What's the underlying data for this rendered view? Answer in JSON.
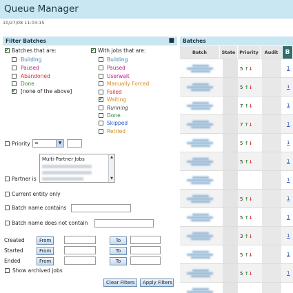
{
  "header": {
    "title": "Queue Manager",
    "timestamp": "10/27/08 11:03:15"
  },
  "filter": {
    "title": "Filter Batches",
    "collapse_icon": "collapse-icon",
    "batches_that_are": {
      "label": "Batches that are:",
      "checked": true,
      "options": [
        {
          "label": "Building",
          "checked": false,
          "color": "#3a7fb0"
        },
        {
          "label": "Paused",
          "checked": false,
          "color": "#c2188c"
        },
        {
          "label": "Abandoned",
          "checked": false,
          "color": "#d43030"
        },
        {
          "label": "Done",
          "checked": false,
          "color": "#2f8a40"
        },
        {
          "label": "[none of the above]",
          "checked": true,
          "color": "#222222"
        }
      ]
    },
    "jobs_that_are": {
      "label": "With jobs that are:",
      "checked": true,
      "options": [
        {
          "label": "Building",
          "checked": false
        },
        {
          "label": "Paused",
          "checked": false
        },
        {
          "label": "Userwait",
          "checked": false
        },
        {
          "label": "Manually Forced",
          "checked": false
        },
        {
          "label": "Failed",
          "checked": false
        },
        {
          "label": "Waiting",
          "checked": true
        },
        {
          "label": "Running",
          "checked": false
        },
        {
          "label": "Done",
          "checked": false
        },
        {
          "label": "Skipped",
          "checked": false
        },
        {
          "label": "Retried",
          "checked": false
        }
      ]
    },
    "priority": {
      "label": "Priority",
      "operator": "=",
      "value": ""
    },
    "partner": {
      "label": "Partner is",
      "first_option": "Multi-Partner Jobs"
    },
    "current_entity": {
      "label": "Current entity only"
    },
    "name_contains": {
      "label": "Batch name contains"
    },
    "name_not_contains": {
      "label": "Batch name does not contain"
    },
    "dates": {
      "from_label": "From",
      "to_label": "To",
      "rows": [
        {
          "label": "Created"
        },
        {
          "label": "Started"
        },
        {
          "label": "Ended"
        }
      ]
    },
    "show_archived": {
      "label": "Show archived jobs"
    },
    "clear_label": "Clear Filters",
    "apply_label": "Apply Filters"
  },
  "batches": {
    "title": "Batches",
    "columns": [
      "Batch",
      "State",
      "Priority",
      "Audit",
      "B"
    ],
    "rows": [
      {
        "priority": "5",
        "link": "1"
      },
      {
        "priority": "5",
        "link": "1"
      },
      {
        "priority": "7",
        "link": "1"
      },
      {
        "priority": "7",
        "link": "1"
      },
      {
        "priority": "5",
        "link": "1"
      },
      {
        "priority": "5",
        "link": "1"
      },
      {
        "priority": "",
        "link": "1"
      },
      {
        "priority": "5",
        "link": "1"
      },
      {
        "priority": "5",
        "link": "1"
      },
      {
        "priority": "3",
        "link": "1"
      },
      {
        "priority": "5",
        "link": "1"
      },
      {
        "priority": "5",
        "link": "1"
      },
      {
        "priority": "",
        "link": ""
      }
    ]
  }
}
